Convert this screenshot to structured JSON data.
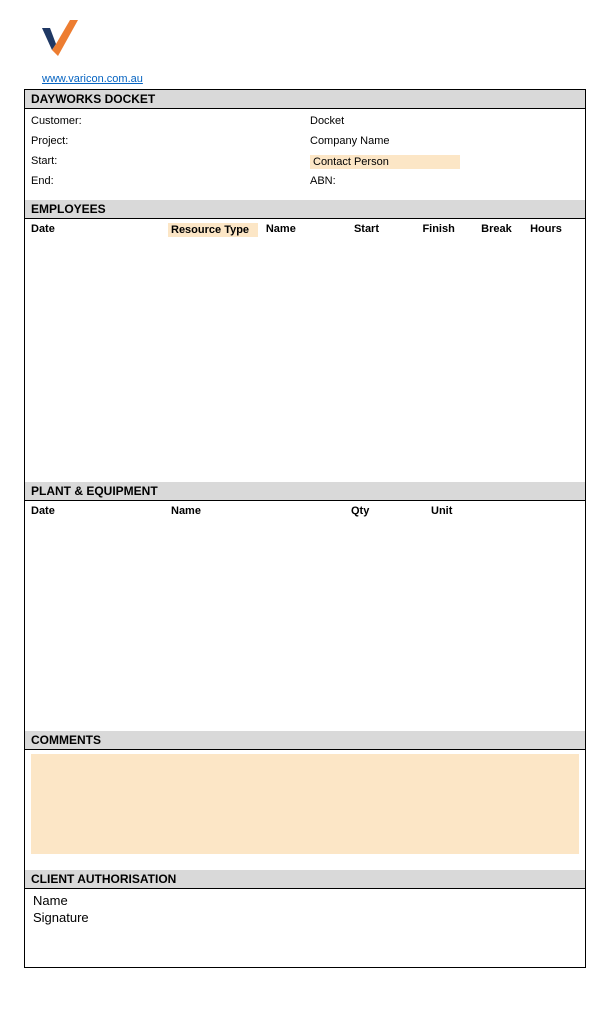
{
  "link": "www.varicon.com.au",
  "sections": {
    "docket": {
      "title": "DAYWORKS DOCKET",
      "left": {
        "customer": "Customer:",
        "project": "Project:",
        "start": "Start:",
        "end": "End:"
      },
      "right": {
        "docket": "Docket",
        "company": "Company Name",
        "contact": "Contact Person",
        "abn": "ABN:"
      }
    },
    "employees": {
      "title": "EMPLOYEES",
      "columns": {
        "date": "Date",
        "resource": "Resource Type",
        "name": "Name",
        "start": "Start",
        "finish": "Finish",
        "break": "Break",
        "hours": "Hours"
      }
    },
    "plant": {
      "title": "PLANT & EQUIPMENT",
      "columns": {
        "date": "Date",
        "name": "Name",
        "qty": "Qty",
        "unit": "Unit"
      }
    },
    "comments": {
      "title": "COMMENTS"
    },
    "client": {
      "title": "CLIENT AUTHORISATION",
      "name": "Name",
      "signature": "Signature"
    }
  }
}
